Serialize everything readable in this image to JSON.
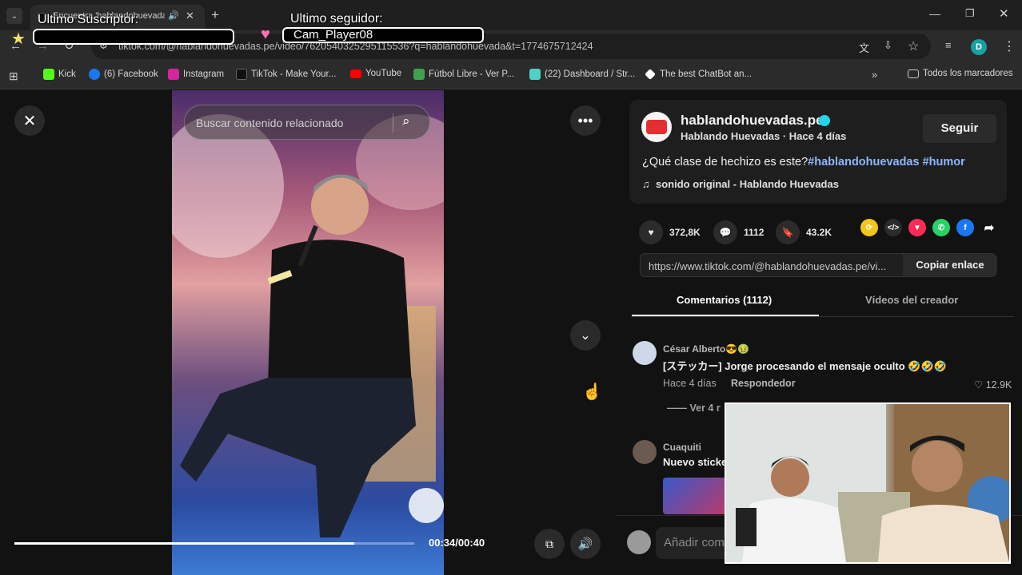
{
  "browser": {
    "tab_title": "Encuentra 'hablandohuevada",
    "url": "tiktok.com/@hablandohuevadas.pe/video/7620540325295115536?q=hablandohuevada&t=1774675712424",
    "profile_initial": "D",
    "bookmarks": [
      {
        "label": "Kick",
        "color": "#53fc18"
      },
      {
        "label": "(6) Facebook",
        "color": "#1877f2"
      },
      {
        "label": "Instagram",
        "color": "#d6249f"
      },
      {
        "label": "TikTok - Make Your...",
        "color": "#111111"
      },
      {
        "label": "YouTube",
        "color": "#ff0000"
      },
      {
        "label": "Fútbol Libre - Ver P...",
        "color": "#3fa34d"
      },
      {
        "label": "(22) Dashboard / Str...",
        "color": "#4fd1c5"
      },
      {
        "label": "The best ChatBot an...",
        "color": "#ffffff"
      }
    ],
    "all_bookmarks": "Todos los marcadores"
  },
  "overlay": {
    "last_subscriber_label": "Ultimo Suscriptor:",
    "last_subscriber_value": "",
    "last_follower_label": "Ultimo seguidor:",
    "last_follower_value": "Cam_Player08"
  },
  "video": {
    "search_placeholder": "Buscar contenido relacionado",
    "time": "00:34/00:40",
    "progress": 0.85
  },
  "post": {
    "username": "hablandohuevadas.pe",
    "subtitle": "Hablando Huevadas · Hace 4 días",
    "follow_label": "Seguir",
    "caption_text": "¿Qué clase de hechizo es este?",
    "hashtag1": "#hablandohuevadas",
    "hashtag2": "#humor",
    "sound": "sonido original - Hablando Huevadas",
    "likes": "372,8K",
    "comments": "1112",
    "saves": "43.2K",
    "link": "https://www.tiktok.com/@hablandohuevadas.pe/vi...",
    "copy_label": "Copiar enlace",
    "tab_comments": "Comentarios (1112)",
    "tab_creator": "Vídeos del creador",
    "add_comment_placeholder": "Añadir com"
  },
  "comments": [
    {
      "name": "César Alberto😎🤢",
      "text": "[ステッカー] Jorge procesando el mensaje oculto 🤣🤣🤣",
      "time": "Hace 4 días",
      "reply": "Respondedor",
      "likes": "12.9K",
      "more": "Ver 4 r"
    },
    {
      "name": "Cuaquiti",
      "text": "Nuevo sticke"
    }
  ]
}
